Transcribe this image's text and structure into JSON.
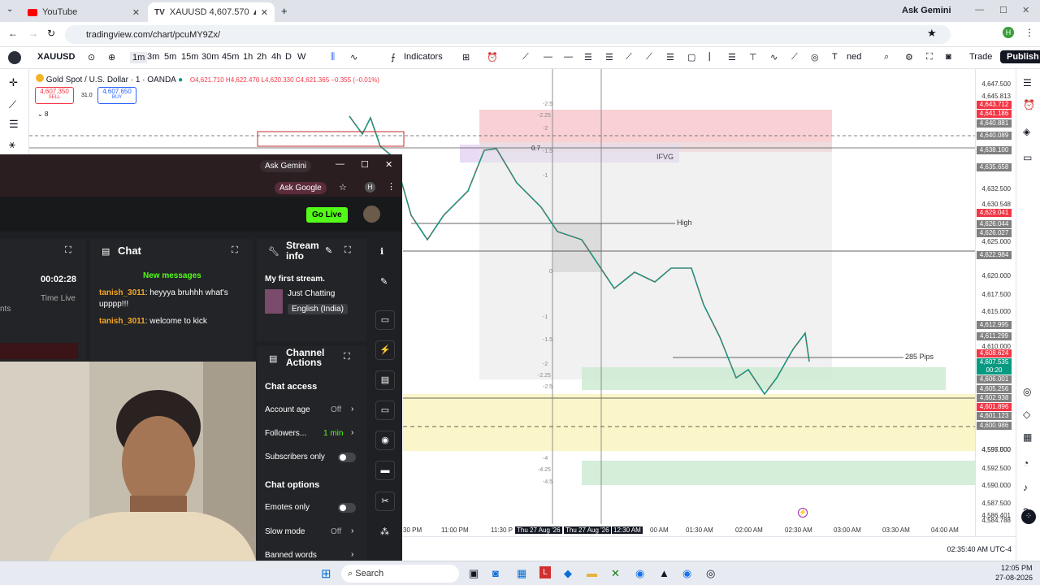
{
  "browser": {
    "tabs": [
      {
        "title": "YouTube"
      },
      {
        "title": "XAUUSD 4,607.570 ▲ +0.28% U"
      }
    ],
    "ask_gemini": "Ask Gemini",
    "url": "tradingview.com/chart/pcuMY9Zx/",
    "profile": "H"
  },
  "toolbar": {
    "symbol": "XAUUSD",
    "intervals": [
      "1m",
      "3m",
      "5m",
      "15m",
      "30m",
      "45m",
      "1h",
      "2h",
      "4h",
      "D",
      "W"
    ],
    "indicators": "Indicators",
    "trade": "Trade",
    "publish": "Publish",
    "ned": "ned"
  },
  "legend": {
    "title": "Gold Spot / U.S. Dollar · 1 · OANDA",
    "ohlc": "O4,621.710 H4,622.470 L4,620.330 C4,621.365 −0.355 (−0.01%)",
    "sell_price": "4,607.350",
    "sell_label": "SELL",
    "spread": "31.0",
    "buy_price": "4,607.650",
    "buy_label": "BUY",
    "count": "8"
  },
  "chart_labels": {
    "ifvg": "IFVG",
    "high": "High",
    "pips": "285 Pips",
    "fib_07": "0.7",
    "fib_left": [
      "-2.5",
      "-2.25",
      "-2",
      "-1.5",
      "-1",
      "0",
      "-1",
      "-1.5",
      "-2",
      "-2.25",
      "-2.5",
      "-4",
      "-4.25",
      "-4.5"
    ]
  },
  "price_axis": {
    "ticks": [
      "4,647.500",
      "4,645.813",
      "4,632.500",
      "4,630.548",
      "4,625.000",
      "4,620.000",
      "4,617.500",
      "4,615.000",
      "4,610.000",
      "4,597.500",
      "4,595.000",
      "4,592.500",
      "4,590.000",
      "4,587.500",
      "4,586.401",
      "4,584.788"
    ],
    "tags": [
      {
        "v": "4,643.712",
        "c": "#f23645"
      },
      {
        "v": "4,641.186",
        "c": "#f23645"
      },
      {
        "v": "4,640.881",
        "c": "#808080"
      },
      {
        "v": "4,640.089",
        "c": "#808080"
      },
      {
        "v": "4,638.100",
        "c": "#808080"
      },
      {
        "v": "4,635.658",
        "c": "#808080"
      },
      {
        "v": "4,629.041",
        "c": "#f23645"
      },
      {
        "v": "4,626.044",
        "c": "#808080"
      },
      {
        "v": "4,626.027",
        "c": "#808080"
      },
      {
        "v": "4,622.984",
        "c": "#808080"
      },
      {
        "v": "4,612.995",
        "c": "#808080"
      },
      {
        "v": "4,611.299",
        "c": "#808080"
      },
      {
        "v": "4,608.624",
        "c": "#f23645"
      },
      {
        "v": "4,607.535",
        "c": "#089981"
      },
      {
        "v": "00:20",
        "c": "#089981"
      },
      {
        "v": "4,606.001",
        "c": "#808080"
      },
      {
        "v": "4,605.256",
        "c": "#808080"
      },
      {
        "v": "4,602.938",
        "c": "#808080"
      },
      {
        "v": "4,601.896",
        "c": "#f23645"
      },
      {
        "v": "4,601.123",
        "c": "#808080"
      },
      {
        "v": "4,600.986",
        "c": "#808080"
      }
    ]
  },
  "time_axis": {
    "ticks": [
      "30 PM",
      "11:00 PM",
      "11:30 P",
      "Thu 27 Aug '26",
      "Thu 27 Aug '26",
      "12:30 AM",
      "00 AM",
      "01:30 AM",
      "02:00 AM",
      "02:30 AM",
      "03:00 AM",
      "03:30 AM",
      "04:00 AM"
    ]
  },
  "status": {
    "clock": "02:35:40 AM UTC-4"
  },
  "kick": {
    "ask_gemini": "Ask Gemini",
    "ask_google": "Ask Google",
    "profile": "H",
    "go_live": "Go Live",
    "session": {
      "duration": "00:02:28",
      "duration_label": "Time Live",
      "cut": "nts"
    },
    "chat": {
      "title": "Chat",
      "new_messages": "New messages",
      "messages": [
        {
          "user": "tanish_3011",
          "text": "heyyya bruhhh what's upppp!!!"
        },
        {
          "user": "tanish_3011",
          "text": "welcome to kick"
        }
      ]
    },
    "stream_info": {
      "title": "Stream info",
      "name": "My first stream.",
      "category": "Just Chatting",
      "language": "English (India)"
    },
    "channel_actions": {
      "title": "Channel Actions",
      "chat_access": "Chat access",
      "rows": [
        {
          "label": "Account age",
          "value": "Off"
        },
        {
          "label": "Followers...",
          "value": "1 min"
        },
        {
          "label": "Subscribers only",
          "value": ""
        }
      ],
      "chat_options": "Chat options",
      "rows2": [
        {
          "label": "Emotes only",
          "value": ""
        },
        {
          "label": "Slow mode",
          "value": "Off"
        },
        {
          "label": "Banned words",
          "value": ""
        }
      ]
    }
  },
  "taskbar": {
    "search": "Search",
    "time": "12:05 PM",
    "date": "27-08-2026"
  },
  "colors": {
    "red_zone": "#f7c5cb",
    "green_zone": "#cdebd3",
    "yellow_zone": "#fbf6c9",
    "purple_zone": "#e3d2f3",
    "grey_zone": "#e6e6e6"
  }
}
